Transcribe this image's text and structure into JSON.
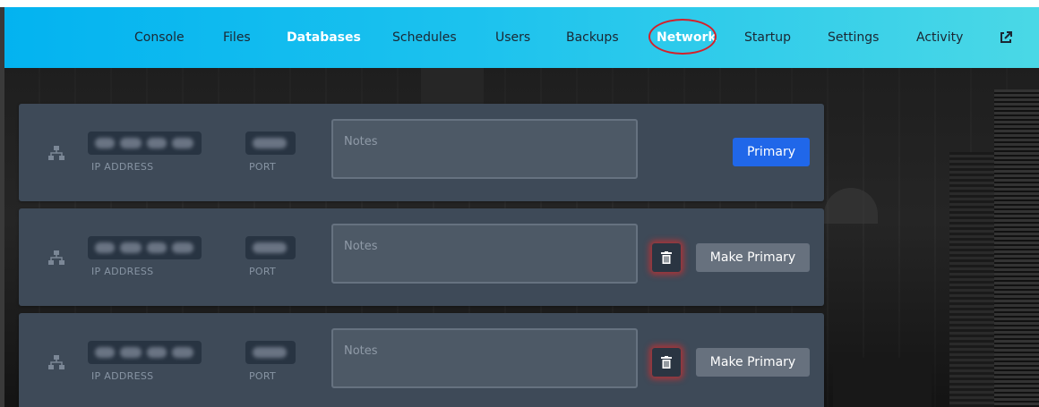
{
  "nav": {
    "items": [
      {
        "label": "Console"
      },
      {
        "label": "Files"
      },
      {
        "label": "Databases"
      },
      {
        "label": "Schedules"
      },
      {
        "label": "Users"
      },
      {
        "label": "Backups"
      },
      {
        "label": "Network"
      },
      {
        "label": "Startup"
      },
      {
        "label": "Settings"
      },
      {
        "label": "Activity"
      }
    ],
    "active": "Databases",
    "highlighted": "Network",
    "external_icon": "external-link-icon"
  },
  "allocations": [
    {
      "icon": "network-icon",
      "ip_label": "IP ADDRESS",
      "port_label": "PORT",
      "notes_placeholder": "Notes",
      "action_label": "Primary"
    },
    {
      "icon": "network-icon",
      "ip_label": "IP ADDRESS",
      "port_label": "PORT",
      "notes_placeholder": "Notes",
      "delete_icon": "trash-icon",
      "action_label": "Make Primary"
    },
    {
      "icon": "network-icon",
      "ip_label": "IP ADDRESS",
      "port_label": "PORT",
      "notes_placeholder": "Notes",
      "delete_icon": "trash-icon",
      "action_label": "Make Primary"
    }
  ],
  "colors": {
    "nav_gradient_start": "#03b3f0",
    "nav_gradient_end": "#4ad8e6",
    "card_bg": "#3e4a58",
    "primary_button": "#2067e9",
    "make_primary_button": "#67717e",
    "highlight_ring": "#d4202a"
  }
}
